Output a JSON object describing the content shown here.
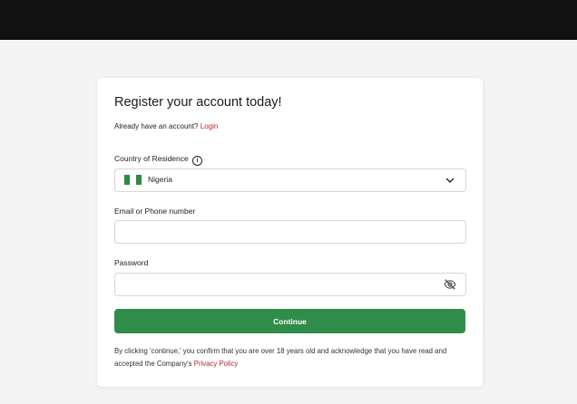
{
  "form": {
    "title": "Register your account today!",
    "login_prompt": "Already have an account?",
    "login_link": "Login",
    "country_label": "Country of Residence",
    "country_value": "Nigeria",
    "email_label": "Email or Phone number",
    "email_value": "",
    "password_label": "Password",
    "password_value": "",
    "continue_label": "Continue",
    "terms_text": "By clicking 'continue,' you confirm that you are over 18 years old and acknowledge that you have read and accepted the Company's",
    "privacy_link": "Privacy Policy"
  },
  "icons": {
    "info": "info-icon",
    "flag": "nigeria-flag-icon",
    "dropdown": "chevron-down-icon",
    "password_toggle": "eye-off-icon"
  },
  "colors": {
    "accent": "#2f8d49",
    "link": "#b32b2b",
    "header": "#111112",
    "background": "#f4f4f4"
  }
}
